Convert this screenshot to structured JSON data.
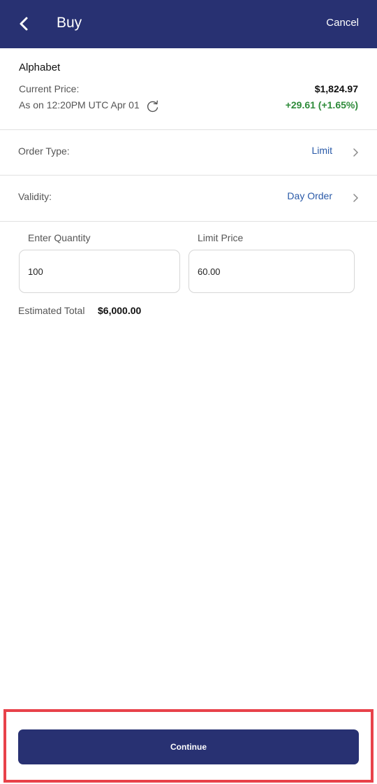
{
  "header": {
    "title": "Buy",
    "cancel_label": "Cancel"
  },
  "stock": {
    "name": "Alphabet",
    "current_price_label": "Current Price:",
    "as_of": "As on 12:20PM UTC Apr 01",
    "price": "$1,824.97",
    "change": "+29.61 (+1.65%)"
  },
  "order_type": {
    "label": "Order Type:",
    "value": "Limit"
  },
  "validity": {
    "label": "Validity:",
    "value": "Day Order"
  },
  "quantity": {
    "label": "Enter Quantity",
    "value": "100"
  },
  "limit_price": {
    "label": "Limit Price",
    "value": "60.00"
  },
  "estimated_total": {
    "label": "Estimated Total",
    "value": "$6,000.00"
  },
  "continue_label": "Continue",
  "colors": {
    "primary": "#283172",
    "positive": "#2e8b3a",
    "link": "#2a5aa8",
    "highlight": "#e8424a"
  },
  "icons": {
    "back": "chevron-left-icon",
    "refresh": "refresh-icon",
    "row_arrow": "chevron-right-icon"
  }
}
